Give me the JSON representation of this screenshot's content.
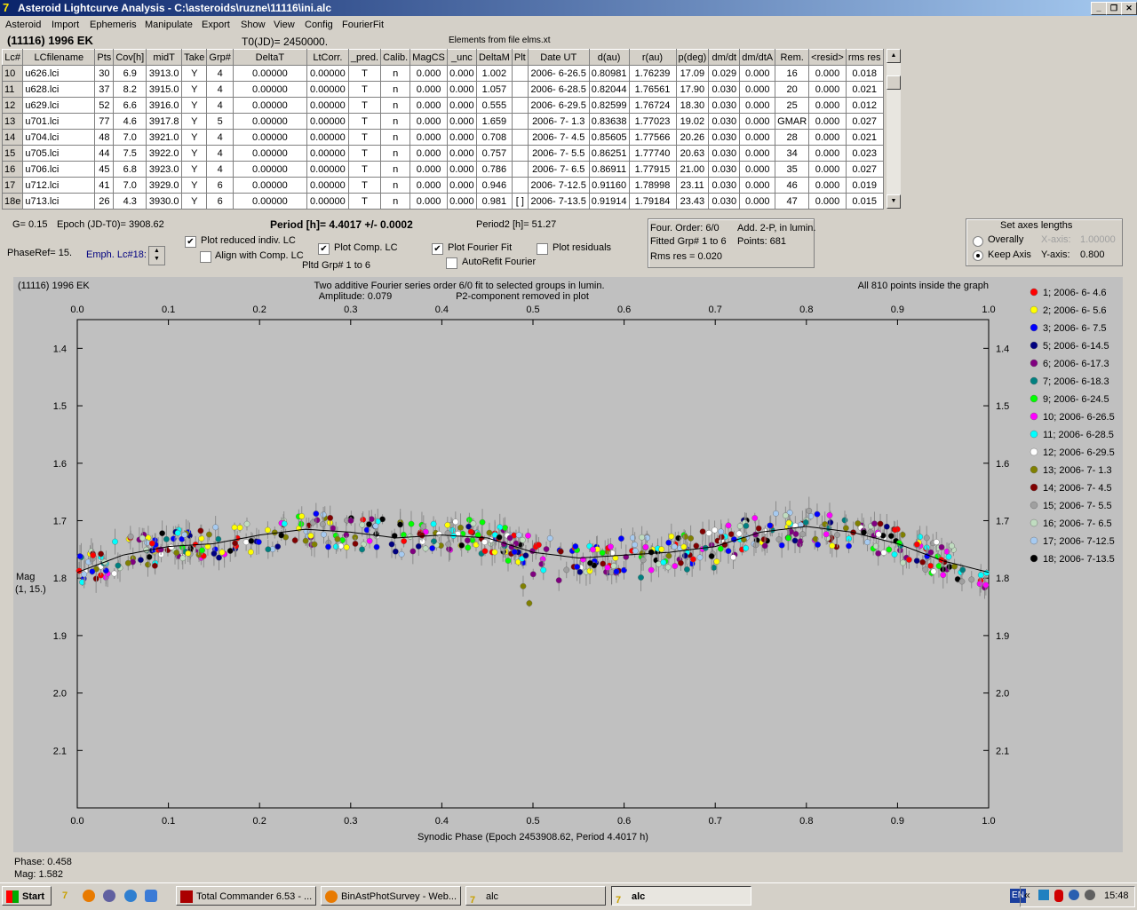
{
  "window": {
    "title": "Asteroid Lightcurve Analysis - C:\\asteroids\\ruzne\\11116\\ini.alc"
  },
  "menu": [
    "Asteroid",
    "Import",
    "Ephemeris",
    "Manipulate",
    "Export",
    "Show",
    "View",
    "Config",
    "FourierFit"
  ],
  "header": {
    "object": "(11116) 1996 EK",
    "t0": "T0(JD)= 2450000.",
    "elements": "Elements from file elms.xt"
  },
  "table": {
    "columns": [
      "Lc#",
      "LCfilename",
      "Pts",
      "Cov[h]",
      "midT",
      "Take",
      "Grp#",
      "DeltaT",
      "LtCorr.",
      "_pred.",
      "Calib.",
      "MagCS",
      "_unc",
      "DeltaM",
      "Plt",
      "Date UT",
      "d(au)",
      "r(au)",
      "p(deg)",
      "dm/dt",
      "dm/dtA",
      "Rem.",
      "<resid>",
      "rms res"
    ],
    "rows": [
      [
        "10",
        "u626.lci",
        "30",
        "6.9",
        "3913.0",
        "Y",
        "4",
        "0.00000",
        "0.00000",
        "T",
        "n",
        "0.000",
        "0.000",
        "1.002",
        "",
        "2006- 6-26.5",
        "0.80981",
        "1.76239",
        "17.09",
        "0.029",
        "0.000",
        "16",
        "0.000",
        "0.018"
      ],
      [
        "11",
        "u628.lci",
        "37",
        "8.2",
        "3915.0",
        "Y",
        "4",
        "0.00000",
        "0.00000",
        "T",
        "n",
        "0.000",
        "0.000",
        "1.057",
        "",
        "2006- 6-28.5",
        "0.82044",
        "1.76561",
        "17.90",
        "0.030",
        "0.000",
        "20",
        "0.000",
        "0.021"
      ],
      [
        "12",
        "u629.lci",
        "52",
        "6.6",
        "3916.0",
        "Y",
        "4",
        "0.00000",
        "0.00000",
        "T",
        "n",
        "0.000",
        "0.000",
        "0.555",
        "",
        "2006- 6-29.5",
        "0.82599",
        "1.76724",
        "18.30",
        "0.030",
        "0.000",
        "25",
        "0.000",
        "0.012"
      ],
      [
        "13",
        "u701.lci",
        "77",
        "4.6",
        "3917.8",
        "Y",
        "5",
        "0.00000",
        "0.00000",
        "T",
        "n",
        "0.000",
        "0.000",
        "1.659",
        "",
        "2006- 7- 1.3",
        "0.83638",
        "1.77023",
        "19.02",
        "0.030",
        "0.000",
        "GMAR",
        "0.000",
        "0.027"
      ],
      [
        "14",
        "u704.lci",
        "48",
        "7.0",
        "3921.0",
        "Y",
        "4",
        "0.00000",
        "0.00000",
        "T",
        "n",
        "0.000",
        "0.000",
        "0.708",
        "",
        "2006- 7- 4.5",
        "0.85605",
        "1.77566",
        "20.26",
        "0.030",
        "0.000",
        "28",
        "0.000",
        "0.021"
      ],
      [
        "15",
        "u705.lci",
        "44",
        "7.5",
        "3922.0",
        "Y",
        "4",
        "0.00000",
        "0.00000",
        "T",
        "n",
        "0.000",
        "0.000",
        "0.757",
        "",
        "2006- 7- 5.5",
        "0.86251",
        "1.77740",
        "20.63",
        "0.030",
        "0.000",
        "34",
        "0.000",
        "0.023"
      ],
      [
        "16",
        "u706.lci",
        "45",
        "6.8",
        "3923.0",
        "Y",
        "4",
        "0.00000",
        "0.00000",
        "T",
        "n",
        "0.000",
        "0.000",
        "0.786",
        "",
        "2006- 7- 6.5",
        "0.86911",
        "1.77915",
        "21.00",
        "0.030",
        "0.000",
        "35",
        "0.000",
        "0.027"
      ],
      [
        "17",
        "u712.lci",
        "41",
        "7.0",
        "3929.0",
        "Y",
        "6",
        "0.00000",
        "0.00000",
        "T",
        "n",
        "0.000",
        "0.000",
        "0.946",
        "",
        "2006- 7-12.5",
        "0.91160",
        "1.78998",
        "23.11",
        "0.030",
        "0.000",
        "46",
        "0.000",
        "0.019"
      ],
      [
        "18e",
        "u713.lci",
        "26",
        "4.3",
        "3930.0",
        "Y",
        "6",
        "0.00000",
        "0.00000",
        "T",
        "n",
        "0.000",
        "0.000",
        "0.981",
        "[ ]",
        "2006- 7-13.5",
        "0.91914",
        "1.79184",
        "23.43",
        "0.030",
        "0.000",
        "47",
        "0.000",
        "0.015"
      ]
    ]
  },
  "controls": {
    "g": "G= 0.15",
    "epoch": "Epoch (JD-T0)= 3908.62",
    "period": "Period [h]= 4.4017 +/- 0.0002",
    "period2": "Period2 [h]= 51.27",
    "phase_ref": "PhaseRef= 15.",
    "emph": "Emph. Lc#18:",
    "plot_reduced": "Plot reduced indiv. LC",
    "align": "Align with Comp. LC",
    "plot_comp": "Plot Comp. LC",
    "pltd_grp": "Pltd Grp#  1  to  6",
    "plot_fourier": "Plot Fourier Fit",
    "plot_resid": "Plot residuals",
    "autorefit": "AutoRefit Fourier"
  },
  "fourier_box": {
    "order": "Four. Order:  6/0",
    "add": "Add. 2-P, in lumin.",
    "fitted": "Fitted Grp# 1 to 6",
    "points": "Points: 681",
    "rms": "Rms res     = 0.020"
  },
  "axes_box": {
    "title": "Set axes lengths",
    "overally": "Overally",
    "keep": "Keep Axis",
    "xaxis_label": "X-axis:",
    "xaxis_val": "1.00000",
    "yaxis_label": "Y-axis:",
    "yaxis_val": "0.800"
  },
  "plot": {
    "title_left": "(11116) 1996 EK",
    "title_center1": "Two additive Fourier series order 6/0 fit to selected groups in lumin.",
    "title_center2a": "Amplitude: 0.079",
    "title_center2b": "P2-component removed in plot",
    "title_right": "All 810 points inside the graph",
    "ylabel1": "Mag",
    "ylabel2": "(1, 15.)",
    "xlabel": "Synodic Phase (Epoch 2453908.62, Period 4.4017 h)"
  },
  "chart_data": {
    "type": "scatter",
    "xlim": [
      0.0,
      1.0
    ],
    "ylim": [
      2.2,
      1.35
    ],
    "xticks": [
      "0.0",
      "0.1",
      "0.2",
      "0.3",
      "0.4",
      "0.5",
      "0.6",
      "0.7",
      "0.8",
      "0.9",
      "1.0"
    ],
    "yticks": [
      "1.4",
      "1.5",
      "1.6",
      "1.7",
      "1.8",
      "1.9",
      "2.0",
      "2.1"
    ],
    "fit_curve": {
      "x": [
        0.0,
        0.05,
        0.1,
        0.15,
        0.2,
        0.25,
        0.3,
        0.35,
        0.4,
        0.45,
        0.5,
        0.55,
        0.6,
        0.65,
        0.7,
        0.75,
        0.8,
        0.85,
        0.9,
        0.95,
        1.0
      ],
      "y": [
        1.79,
        1.76,
        1.745,
        1.74,
        1.725,
        1.715,
        1.72,
        1.73,
        1.725,
        1.73,
        1.755,
        1.765,
        1.76,
        1.755,
        1.745,
        1.72,
        1.71,
        1.72,
        1.74,
        1.77,
        1.79
      ]
    },
    "legend": [
      {
        "label": "1; 2006- 6- 4.6",
        "color": "#ff0000"
      },
      {
        "label": "2; 2006- 6- 5.6",
        "color": "#ffff00"
      },
      {
        "label": "3; 2006- 6- 7.5",
        "color": "#0000ff"
      },
      {
        "label": "5; 2006- 6-14.5",
        "color": "#000080"
      },
      {
        "label": "6; 2006- 6-17.3",
        "color": "#800080"
      },
      {
        "label": "7; 2006- 6-18.3",
        "color": "#008080"
      },
      {
        "label": "9; 2006- 6-24.5",
        "color": "#00ff00"
      },
      {
        "label": "10; 2006- 6-26.5",
        "color": "#ff00ff"
      },
      {
        "label": "11; 2006- 6-28.5",
        "color": "#00ffff"
      },
      {
        "label": "12; 2006- 6-29.5",
        "color": "#ffffff"
      },
      {
        "label": "13; 2006- 7- 1.3",
        "color": "#808000"
      },
      {
        "label": "14; 2006- 7- 4.5",
        "color": "#800000"
      },
      {
        "label": "15; 2006- 7- 5.5",
        "color": "#a0a0a0"
      },
      {
        "label": "16; 2006- 7- 6.5",
        "color": "#c0dcc0"
      },
      {
        "label": "17; 2006- 7-12.5",
        "color": "#a6caf0"
      },
      {
        "label": "18; 2006- 7-13.5",
        "color": "#000000"
      }
    ]
  },
  "readout": {
    "phase": "Phase: 0.458",
    "mag": "Mag:   1.582"
  },
  "taskbar": {
    "start": "Start",
    "buttons": [
      "Total Commander 6.53 - ...",
      "BinAstPhotSurvey - Web...",
      "alc",
      "alc"
    ],
    "lang": "EN",
    "clock": "15:48"
  }
}
